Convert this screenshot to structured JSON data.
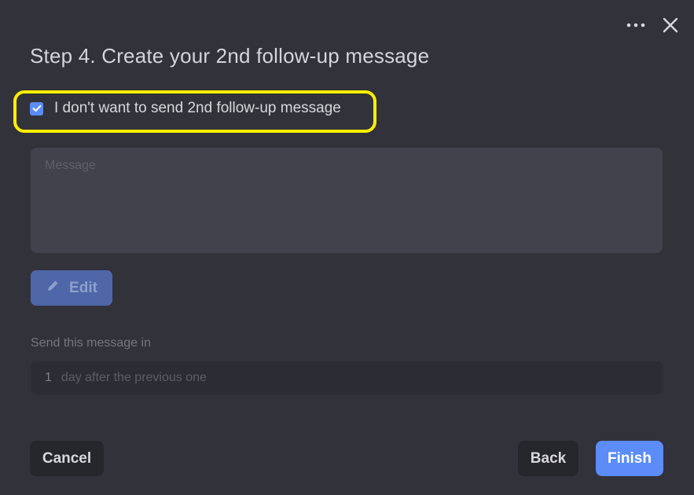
{
  "dialog": {
    "title": "Step 4. Create your 2nd follow-up message",
    "topbar": {
      "more_icon": "more-horizontal-icon",
      "close_icon": "close-icon"
    }
  },
  "skip_option": {
    "checked": true,
    "label": "I don't want to send 2nd follow-up message",
    "highlight_color": "#ffef00"
  },
  "message": {
    "placeholder": "Message",
    "value": ""
  },
  "edit_button": {
    "label": "Edit",
    "icon": "pencil-icon"
  },
  "schedule": {
    "label": "Send this message in",
    "value": "1",
    "suffix": "day after the previous one"
  },
  "footer": {
    "cancel_label": "Cancel",
    "back_label": "Back",
    "finish_label": "Finish"
  },
  "colors": {
    "background": "#32323b",
    "accent": "#5b8cf7",
    "highlight": "#ffef00"
  }
}
